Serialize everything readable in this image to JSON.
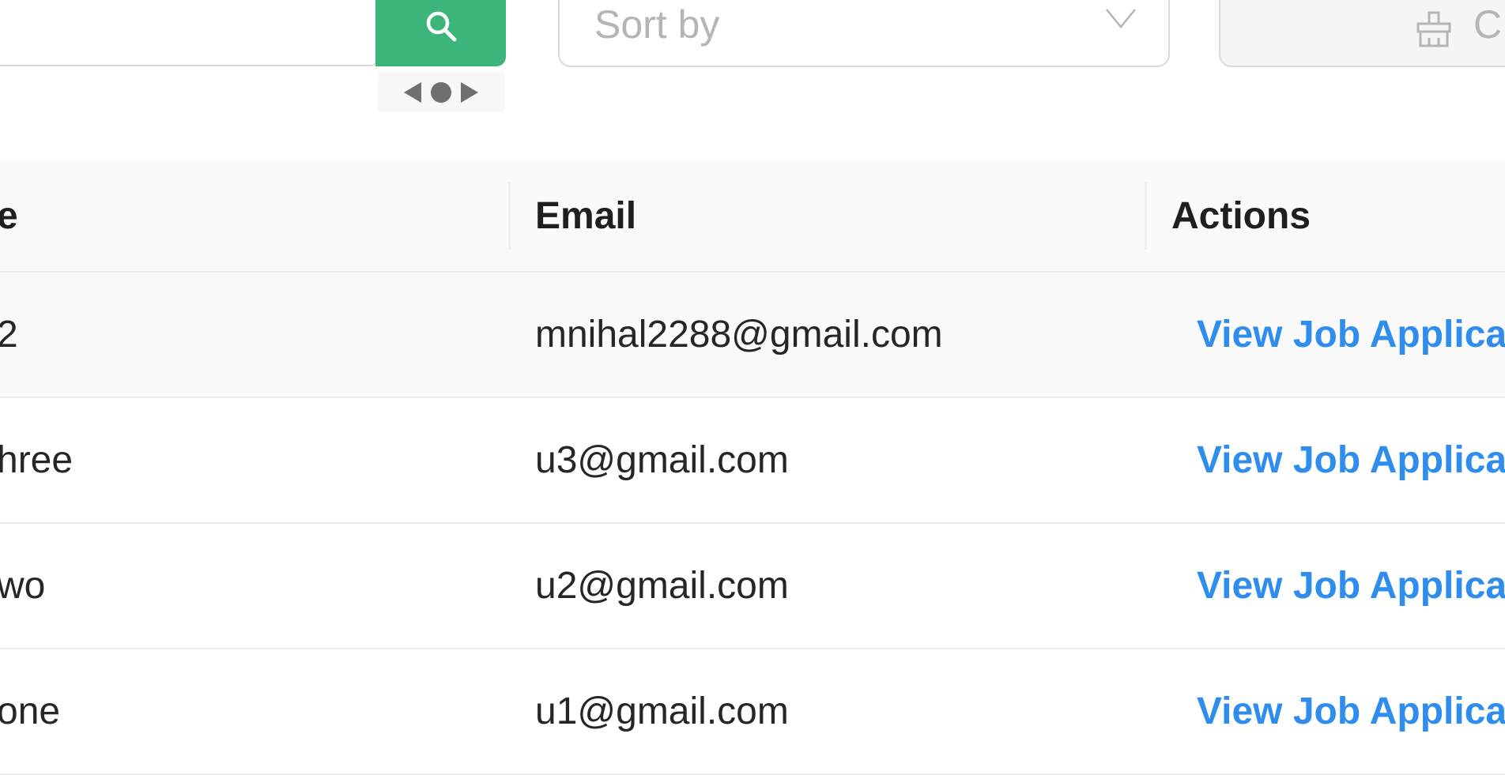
{
  "toolbar": {
    "search": {
      "placeholder": "",
      "button_icon": "search-icon"
    },
    "sort": {
      "placeholder": "Sort by",
      "icon": "chevron-down-icon"
    },
    "clear": {
      "label": "C",
      "icon": "clear-icon"
    }
  },
  "table": {
    "columns": [
      "e",
      "Email",
      "Actions"
    ],
    "rows": [
      {
        "name": "2",
        "email": "mnihal2288@gmail.com",
        "action": "View Job Applicatio"
      },
      {
        "name": "hree",
        "email": "u3@gmail.com",
        "action": "View Job Applicatio"
      },
      {
        "name": "wo",
        "email": "u2@gmail.com",
        "action": "View Job Applicatio"
      },
      {
        "name": "one",
        "email": "u1@gmail.com",
        "action": "View Job Applicatio"
      }
    ]
  },
  "colors": {
    "accent": "#3cb57b",
    "link": "#2f8eed"
  }
}
